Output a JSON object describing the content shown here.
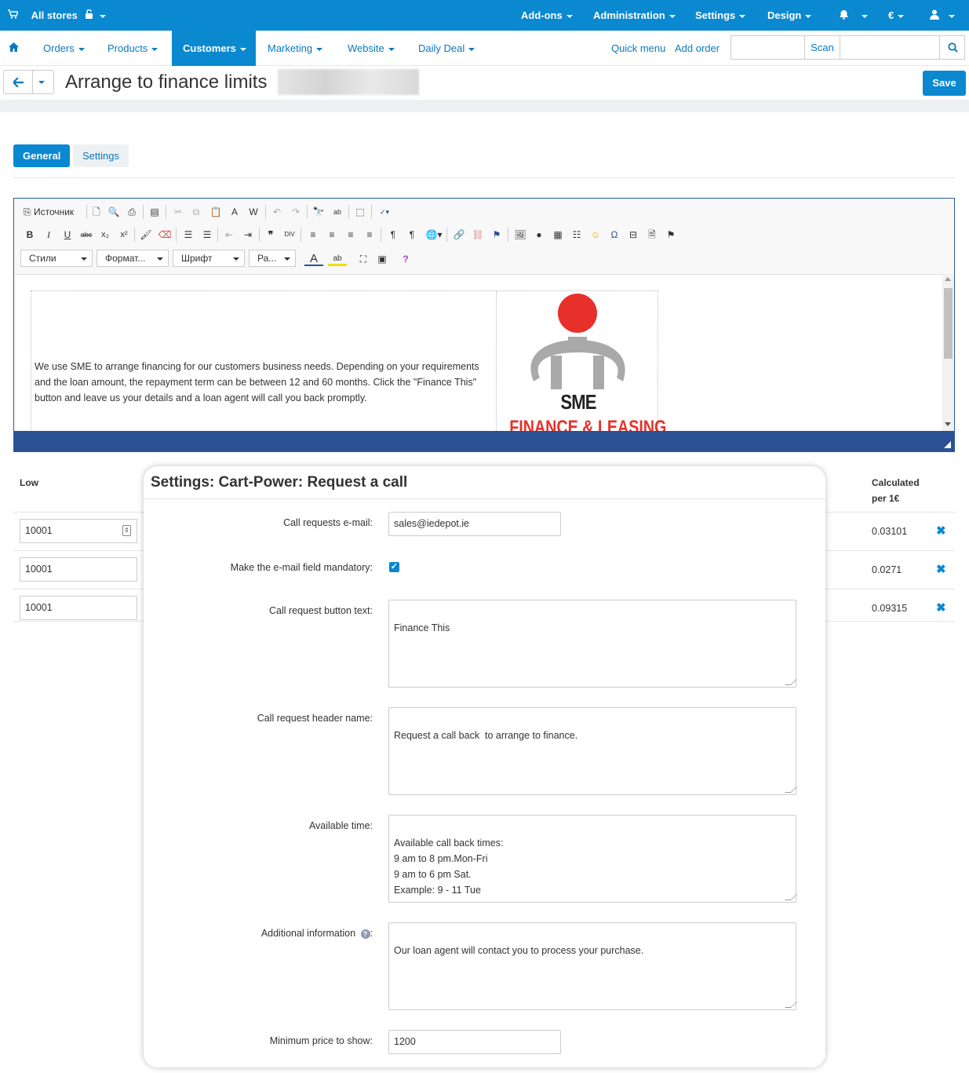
{
  "topbar": {
    "stores_label": "All stores",
    "addons": "Add-ons",
    "administration": "Administration",
    "settings": "Settings",
    "design": "Design",
    "currency": "€"
  },
  "nav": {
    "orders": "Orders",
    "products": "Products",
    "customers": "Customers",
    "marketing": "Marketing",
    "website": "Website",
    "daily_deal": "Daily Deal",
    "quick_menu": "Quick menu",
    "add_order": "Add order",
    "scan": "Scan",
    "search_value": "",
    "scan_value": ""
  },
  "titlebar": {
    "title": "Arrange to finance limits",
    "save": "Save"
  },
  "tabs": [
    "General",
    "Settings"
  ],
  "editor": {
    "source_label": "Источник",
    "styles": "Стили",
    "format": "Формат...",
    "font": "Шрифт",
    "size": "Ра...",
    "content_text": "We use SME to arrange financing for our customers business needs. Depending on your requirements and the loan amount, the repayment term can be between 12 and 60 months. Click the \"Finance This\" button and leave us your details and a loan agent will call you back promptly.",
    "logo_text": "SME",
    "logo_subtext": "FINANCE & LEASING"
  },
  "price_table": {
    "col_low": "Low",
    "col_calc_line1": "Calculated",
    "col_calc_line2": "per 1€",
    "rows": [
      {
        "low": "10001",
        "calc": "0.03101"
      },
      {
        "low": "10001",
        "calc": "0.0271"
      },
      {
        "low": "10001",
        "calc": "0.09315"
      }
    ]
  },
  "popup": {
    "title": "Settings: Cart-Power: Request a call",
    "fields": {
      "email_label": "Call requests e-mail:",
      "email_value": "sales@iedepot.ie",
      "mandatory_label": "Make the e-mail field mandatory:",
      "mandatory_checked": true,
      "button_text_label": "Call request button text:",
      "button_text_value": "Finance This",
      "header_label": "Call request header name:",
      "header_value": "Request a call back  to arrange to finance.",
      "time_label": "Available time:",
      "time_value": "Available call back times:\n9 am to 8 pm.Mon-Fri\n9 am to 6 pm Sat.\nExample: 9 - 11 Tue",
      "info_label": "Additional information",
      "info_value": "Our loan agent will contact you to process your purchase.",
      "min_price_label": "Minimum price to show:",
      "min_price_value": "1200"
    }
  },
  "colors": {
    "primary": "#0a88d0",
    "editor_footer": "#2b5195",
    "logo_red": "#e8302a",
    "logo_gray": "#a9a9a9"
  }
}
